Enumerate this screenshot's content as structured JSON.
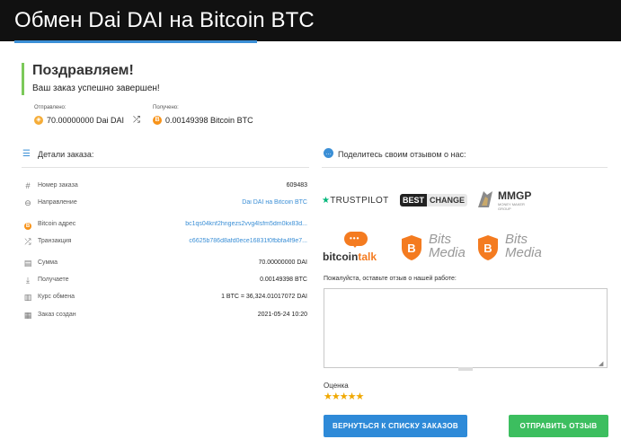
{
  "header": {
    "title": "Обмен Dai DAI на Bitcoin BTC"
  },
  "status": {
    "title": "Поздравляем!",
    "subtitle": "Ваш заказ успешно завершен!"
  },
  "summary": {
    "sent_label": "Отправлено:",
    "sent_value": "70.00000000 Dai DAI",
    "received_label": "Получено:",
    "received_value": "0.00149398 Bitcoin BTC"
  },
  "details": {
    "title": "Детали заказа:",
    "rows": [
      {
        "icon": "hash-icon",
        "label": "Номер заказа",
        "value": "609483"
      },
      {
        "icon": "arrow-right-circle-icon",
        "label": "Направление",
        "value": "Dai DAI на Bitcoin BTC",
        "link": true
      },
      {
        "icon": "bitcoin-icon",
        "label": "Bitcoin адрес",
        "value": "bc1qs04knf2hngezs2vvg4lsfm5dm0kx83d...",
        "link": true
      },
      {
        "icon": "shuffle-icon",
        "label": "Транзакция",
        "value": "c6625b786d8afd0ece16831f0fbbfa4f9e7...",
        "link": true
      },
      {
        "icon": "coins-icon",
        "label": "Сумма",
        "value": "70.00000000 DAI"
      },
      {
        "icon": "download-icon",
        "label": "Получаете",
        "value": "0.00149398 BTC"
      },
      {
        "icon": "bar-chart-icon",
        "label": "Курс обмена",
        "value": "1 BTC = 36,324.01017072 DAI"
      },
      {
        "icon": "calendar-icon",
        "label": "Заказ создан",
        "value": "2021-05-24 10:20"
      }
    ]
  },
  "review": {
    "title": "Поделитесь своим отзывом о нас:",
    "logos": {
      "trustpilot": "TRUSTPILOT",
      "bestchange_1": "BEST",
      "bestchange_2": "CHANGE",
      "mmgp": "MMGP",
      "mmgp_sub": "MONEY MAKER GROUP",
      "bitcointalk_1": "bitcoin",
      "bitcointalk_2": "talk",
      "bits_1": "Bits",
      "bits_2": "Media"
    },
    "prompt": "Пожалуйста, оставьте отзыв о нашей работе:",
    "textarea_value": "",
    "rating_label": "Оценка",
    "stars": "★★★★★",
    "rating": 5
  },
  "buttons": {
    "back": "ВЕРНУТЬСЯ К СПИСКУ ЗАКАЗОВ",
    "send": "ОТПРАВИТЬ ОТЗЫВ"
  },
  "colors": {
    "accent": "#3b8fd6",
    "success": "#7cc95a",
    "send_button": "#3cbe5f",
    "bitcoin": "#f7931a",
    "dai": "#f5ac37"
  }
}
